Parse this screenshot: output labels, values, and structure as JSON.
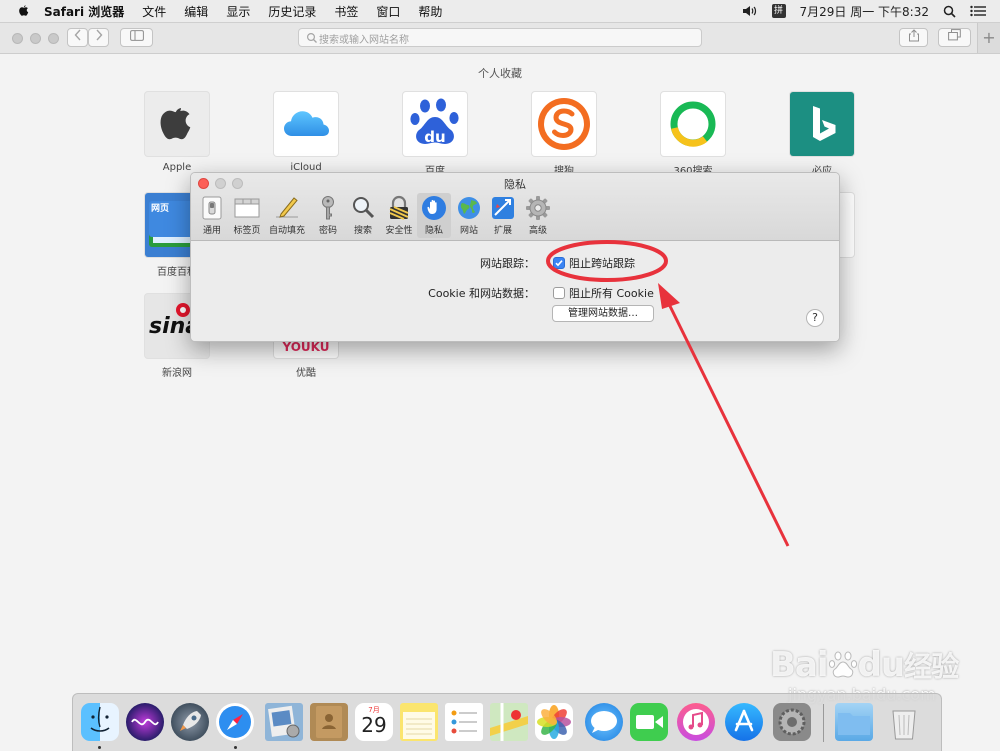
{
  "menubar": {
    "app": "Safari 浏览器",
    "items": [
      "文件",
      "编辑",
      "显示",
      "历史记录",
      "书签",
      "窗口",
      "帮助"
    ],
    "ime": "拼",
    "datetime": "7月29日 周一 下午8:32"
  },
  "toolbar": {
    "search_placeholder": "搜索或输入网站名称",
    "new_tab": "+"
  },
  "favorites": {
    "title": "个人收藏",
    "row1": [
      "Apple",
      "iCloud",
      "百度",
      "搜狗",
      "360搜索",
      "必应"
    ],
    "row2": [
      "百度百科"
    ],
    "row3": [
      "新浪网",
      "优酷"
    ],
    "tile_text": {
      "baidu": "du",
      "baike": "网页",
      "sina": "sina",
      "youku": "YOUKU"
    }
  },
  "prefs": {
    "title": "隐私",
    "tabs": [
      "通用",
      "标签页",
      "自动填充",
      "密码",
      "搜索",
      "安全性",
      "隐私",
      "网站",
      "扩展",
      "高级"
    ],
    "active_tab": "隐私",
    "tracking_label": "网站跟踪：",
    "tracking_option": "阻止跨站跟踪",
    "tracking_checked": true,
    "cookie_label": "Cookie 和网站数据：",
    "cookie_option": "阻止所有 Cookie",
    "cookie_checked": false,
    "manage_button": "管理网站数据…",
    "help_button": "?"
  },
  "dock": {
    "calendar_month": "7月",
    "calendar_day": "29"
  },
  "watermark": {
    "brand": "Bai",
    "brand2": "du",
    "brand_cn": "经验",
    "url": "jingyan.baidu.com"
  },
  "colors": {
    "annotation": "#e8323c",
    "checkbox_on": "#3b84f3"
  }
}
